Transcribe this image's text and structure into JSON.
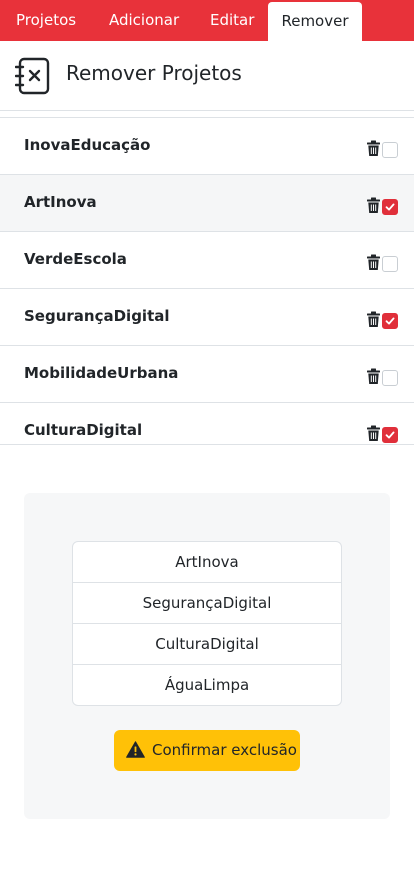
{
  "nav": {
    "tabs": [
      {
        "label": "Projetos"
      },
      {
        "label": "Adicionar"
      },
      {
        "label": "Editar"
      },
      {
        "label": "Remover",
        "active": true
      }
    ]
  },
  "header": {
    "title": "Remover Projetos",
    "icon": "notebook-remove-icon"
  },
  "projects": [
    {
      "name": "InovaEducação",
      "checked": false
    },
    {
      "name": "ArtInova",
      "checked": true
    },
    {
      "name": "VerdeEscola",
      "checked": false
    },
    {
      "name": "SegurançaDigital",
      "checked": true
    },
    {
      "name": "MobilidadeUrbana",
      "checked": false
    },
    {
      "name": "CulturaDigital",
      "checked": true
    }
  ],
  "selection": {
    "items": [
      "ArtInova",
      "SegurançaDigital",
      "CulturaDigital",
      "ÁguaLimpa"
    ]
  },
  "confirm": {
    "label": "Confirmar exclusão",
    "icon": "warning-icon"
  },
  "colors": {
    "nav_bg": "#e8323a",
    "checkbox_checked": "#e02f3a",
    "confirm_bg": "#ffc107",
    "panel_bg": "#f6f7f8"
  }
}
